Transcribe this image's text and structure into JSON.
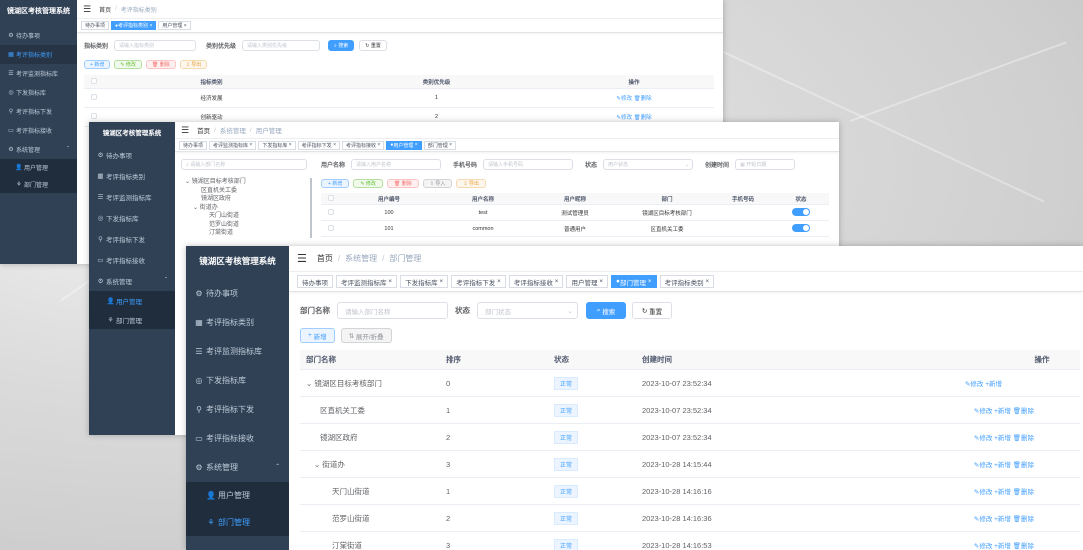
{
  "app_title": "镜湖区考核管理系统",
  "menu": {
    "todo": "待办事项",
    "category": "考评指标类别",
    "monitor": "考评监测指标库",
    "issue_lib": "下发指标库",
    "issue": "考评指标下发",
    "receive": "考评指标接收",
    "system": "系统管理",
    "users": "用户管理",
    "depts": "部门管理"
  },
  "w1": {
    "breadcrumb": {
      "home": "首页",
      "sep": "/",
      "current": "考评指标类别"
    },
    "tags": [
      "待办事项",
      "考评指标类别",
      "用户管理"
    ],
    "filter": {
      "name_label": "指标类别",
      "name_placeholder": "请输入指标类别",
      "prio_label": "类别优先级",
      "prio_placeholder": "请输入类别优先级",
      "search": "搜索",
      "reset": "重置"
    },
    "toolbar": {
      "add": "新增",
      "edit": "修改",
      "del": "删除",
      "export": "导出"
    },
    "table": {
      "headers": [
        "指标类别",
        "类别优先级",
        "操作"
      ],
      "rows": [
        {
          "name": "经济发展",
          "prio": "1"
        },
        {
          "name": "创新驱动",
          "prio": "2"
        }
      ],
      "edit": "修改",
      "del": "删除"
    }
  },
  "w2": {
    "breadcrumb": {
      "home": "首页",
      "sys": "系统管理",
      "current": "用户管理",
      "sep": "/"
    },
    "tags": [
      "待办事项",
      "考评监测指标库",
      "下发指标库",
      "考评指标下发",
      "考评指标接收",
      "用户管理",
      "部门管理"
    ],
    "tree_placeholder": "请输入部门名称",
    "tree": {
      "root": "镜湖区目标考核部门",
      "items": [
        "区直机关工委",
        "镜湖区政府",
        "街道办"
      ],
      "sub": [
        "天门山街道",
        "范罗山街道",
        "汀棠街道"
      ]
    },
    "filter": {
      "user_label": "用户名称",
      "user_placeholder": "请输入用户名称",
      "phone_label": "手机号码",
      "phone_placeholder": "请输入手机号码",
      "status_label": "状态",
      "status_placeholder": "用户状态",
      "time_label": "创建时间",
      "time_placeholder": "开始日期"
    },
    "toolbar": {
      "add": "新增",
      "edit": "修改",
      "del": "删除",
      "import": "导入",
      "export": "导出"
    },
    "table": {
      "headers": [
        "用户编号",
        "用户名称",
        "用户昵称",
        "部门",
        "手机号码",
        "状态"
      ],
      "rows": [
        {
          "id": "100",
          "name": "test",
          "nick": "测试管理员",
          "dept": "镜湖区目标考核部门"
        },
        {
          "id": "101",
          "name": "common",
          "nick": "普通用户",
          "dept": "区直机关工委"
        }
      ]
    }
  },
  "w3": {
    "breadcrumb": {
      "home": "首页",
      "sys": "系统管理",
      "current": "部门管理",
      "sep": "/"
    },
    "tags": [
      "待办事项",
      "考评监测指标库",
      "下发指标库",
      "考评指标下发",
      "考评指标接收",
      "用户管理",
      "部门管理",
      "考评指标类别"
    ],
    "filter": {
      "name_label": "部门名称",
      "name_placeholder": "请输入部门名称",
      "status_label": "状态",
      "status_placeholder": "部门状态",
      "search": "搜索",
      "reset": "重置"
    },
    "toolbar": {
      "add": "新增",
      "expand": "展开/折叠"
    },
    "table": {
      "headers": [
        "部门名称",
        "排序",
        "状态",
        "创建时间",
        "操作"
      ],
      "rows": [
        {
          "name": "镜湖区目标考核部门",
          "order": "0",
          "status": "正常",
          "time": "2023-10-07 23:52:34"
        },
        {
          "name": "区直机关工委",
          "order": "1",
          "status": "正常",
          "time": "2023-10-07 23:52:34"
        },
        {
          "name": "镜湖区政府",
          "order": "2",
          "status": "正常",
          "time": "2023-10-07 23:52:34"
        },
        {
          "name": "街道办",
          "order": "3",
          "status": "正常",
          "time": "2023-10-28 14:15:44"
        },
        {
          "name": "天门山街道",
          "order": "1",
          "status": "正常",
          "time": "2023-10-28 14:16:16"
        },
        {
          "name": "范罗山街道",
          "order": "2",
          "status": "正常",
          "time": "2023-10-28 14:16:36"
        },
        {
          "name": "汀棠街道",
          "order": "3",
          "status": "正常",
          "time": "2023-10-28 14:16:53"
        }
      ],
      "edit": "修改",
      "add": "新增",
      "del": "删除"
    }
  },
  "colors": {
    "sidebar": "#304156",
    "submenu": "#1f2d3d",
    "primary": "#409eff"
  }
}
